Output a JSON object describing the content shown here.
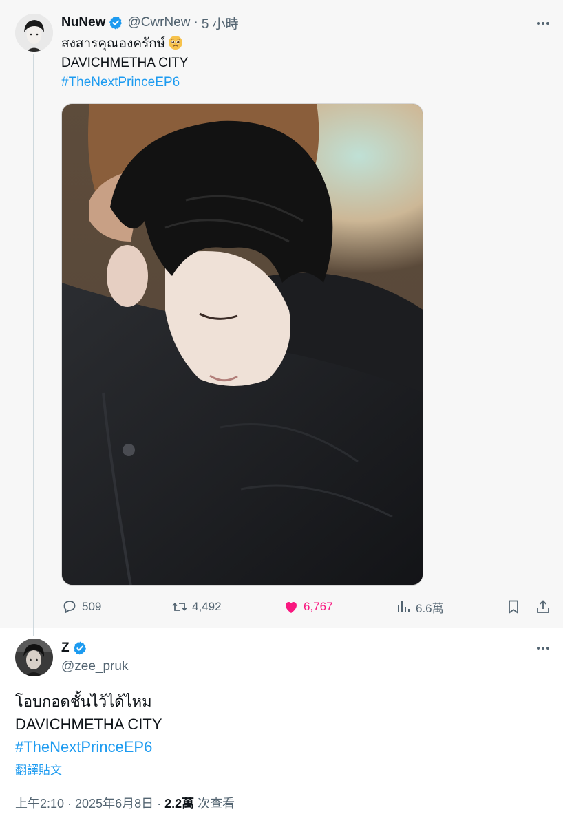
{
  "parent_tweet": {
    "author_name": "NuNew",
    "author_handle": "@CwrNew",
    "separator": "·",
    "time": "5 小時",
    "text_line1": "สงสารคุณองครักษ์",
    "text_line1_emoji": "pleading-face-emoji",
    "text_line2": "DAVICHMETHA CITY",
    "hashtag": "#TheNextPrinceEP6",
    "stats": {
      "replies": "509",
      "retweets": "4,492",
      "likes": "6,767",
      "views": "6.6萬"
    },
    "like_color": "#f91880"
  },
  "main_tweet": {
    "author_name": "Z",
    "author_handle": "@zee_pruk",
    "text_line1": "โอบกอดชั้นไว้ได้ไหม",
    "text_line2": "DAVICHMETHA CITY",
    "hashtag": "#TheNextPrinceEP6",
    "translate_label": "翻譯貼文",
    "timestamp": "上午2:10 · 2025年6月8日",
    "meta_separator": " · ",
    "view_count": "2.2萬",
    "view_suffix": " 次查看"
  },
  "colors": {
    "link": "#1d9bf0",
    "verified": "#1d9bf0",
    "secondary_text": "#536471",
    "parent_background": "#f7f7f7"
  },
  "icons": [
    "verified-badge-icon",
    "more-icon",
    "reply-icon",
    "retweet-icon",
    "heart-icon",
    "views-icon",
    "bookmark-icon",
    "share-icon"
  ]
}
